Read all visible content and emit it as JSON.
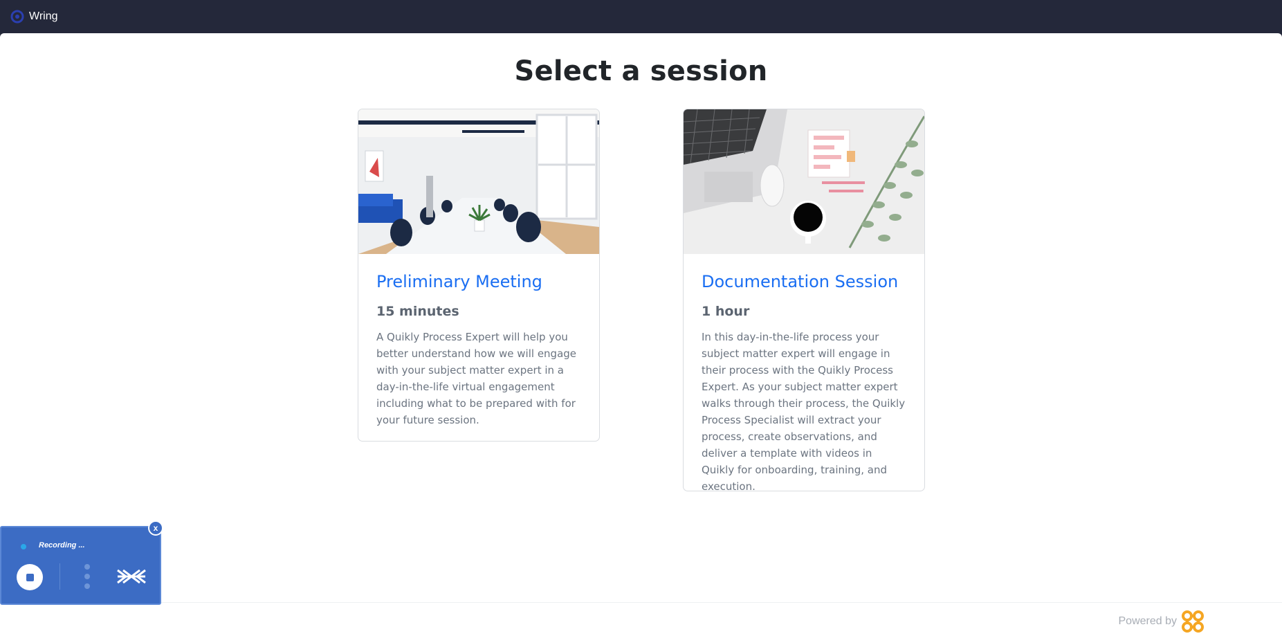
{
  "window": {
    "tab_title": "Wring",
    "logo_icon": "wring-logo-icon"
  },
  "page": {
    "heading": "Select a session"
  },
  "sessions": [
    {
      "title": "Preliminary Meeting",
      "duration": "15 minutes",
      "description": "A Quikly Process Expert will help you better understand how we will engage with your subject matter expert in a day-in-the-life virtual engagement including what to be prepared with for your future session.",
      "image_icon": "conference-room-photo"
    },
    {
      "title": "Documentation Session",
      "duration": "1 hour",
      "description": "In this day-in-the-life process your subject matter expert will engage in their process with the Quikly Process Expert. As your subject matter expert walks through their process, the Quikly Process Specialist will extract your process, create observations, and deliver a template with videos in Quikly for onboarding, training, and execution.",
      "image_icon": "desk-laptop-photo"
    }
  ],
  "recorder": {
    "status": "Recording ...",
    "close_label": "x"
  },
  "footer": {
    "powered_by": "Powered by",
    "brand_icon": "quikly-logo-icon"
  },
  "colors": {
    "topbar": "#24283a",
    "title_link": "#1a6ef2",
    "recorder_bg": "#3c6cc4",
    "brand_orange": "#f5a623"
  }
}
